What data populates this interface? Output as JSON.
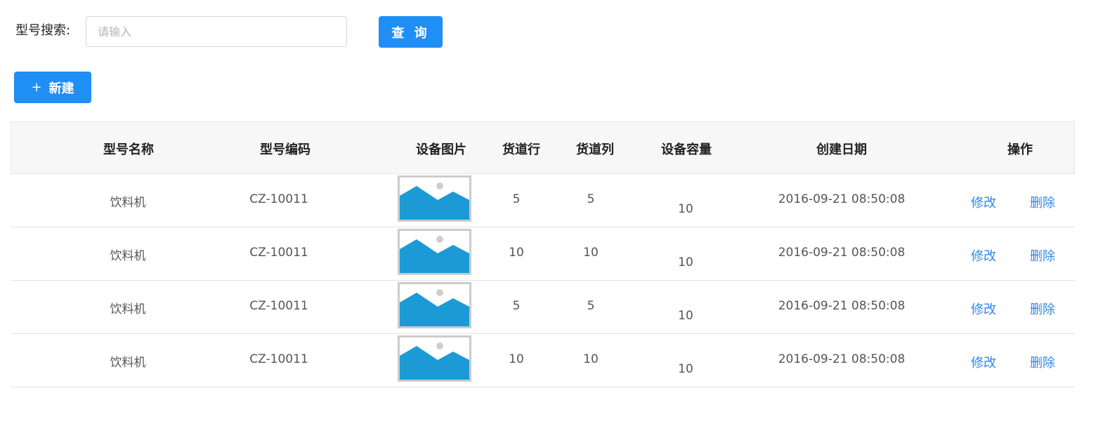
{
  "search": {
    "label": "型号搜索:",
    "placeholder": "请输入",
    "value": "",
    "query_button": "查 询"
  },
  "new_button": {
    "icon": "+",
    "label": "新建"
  },
  "colors": {
    "accent": "#1f8ff5",
    "link": "#2f86ea",
    "image_blue": "#1b9ad6"
  },
  "table": {
    "columns": [
      "型号名称",
      "型号编码",
      "设备图片",
      "货道行",
      "货道列",
      "设备容量",
      "创建日期",
      "操作"
    ],
    "rows": [
      {
        "name": "饮料机",
        "code": "CZ-10011",
        "image": "image-placeholder-icon",
        "lane_rows": "5",
        "lane_cols": "5",
        "capacity": "10",
        "created": "2016-09-21  08:50:08",
        "edit": "修改",
        "delete": "删除"
      },
      {
        "name": "饮料机",
        "code": "CZ-10011",
        "image": "image-placeholder-icon",
        "lane_rows": "10",
        "lane_cols": "10",
        "capacity": "10",
        "created": "2016-09-21  08:50:08",
        "edit": "修改",
        "delete": "删除"
      },
      {
        "name": "饮料机",
        "code": "CZ-10011",
        "image": "image-placeholder-icon",
        "lane_rows": "5",
        "lane_cols": "5",
        "capacity": "10",
        "created": "2016-09-21  08:50:08",
        "edit": "修改",
        "delete": "删除"
      },
      {
        "name": "饮料机",
        "code": "CZ-10011",
        "image": "image-placeholder-icon",
        "lane_rows": "10",
        "lane_cols": "10",
        "capacity": "10",
        "created": "2016-09-21  08:50:08",
        "edit": "修改",
        "delete": "删除"
      }
    ]
  }
}
